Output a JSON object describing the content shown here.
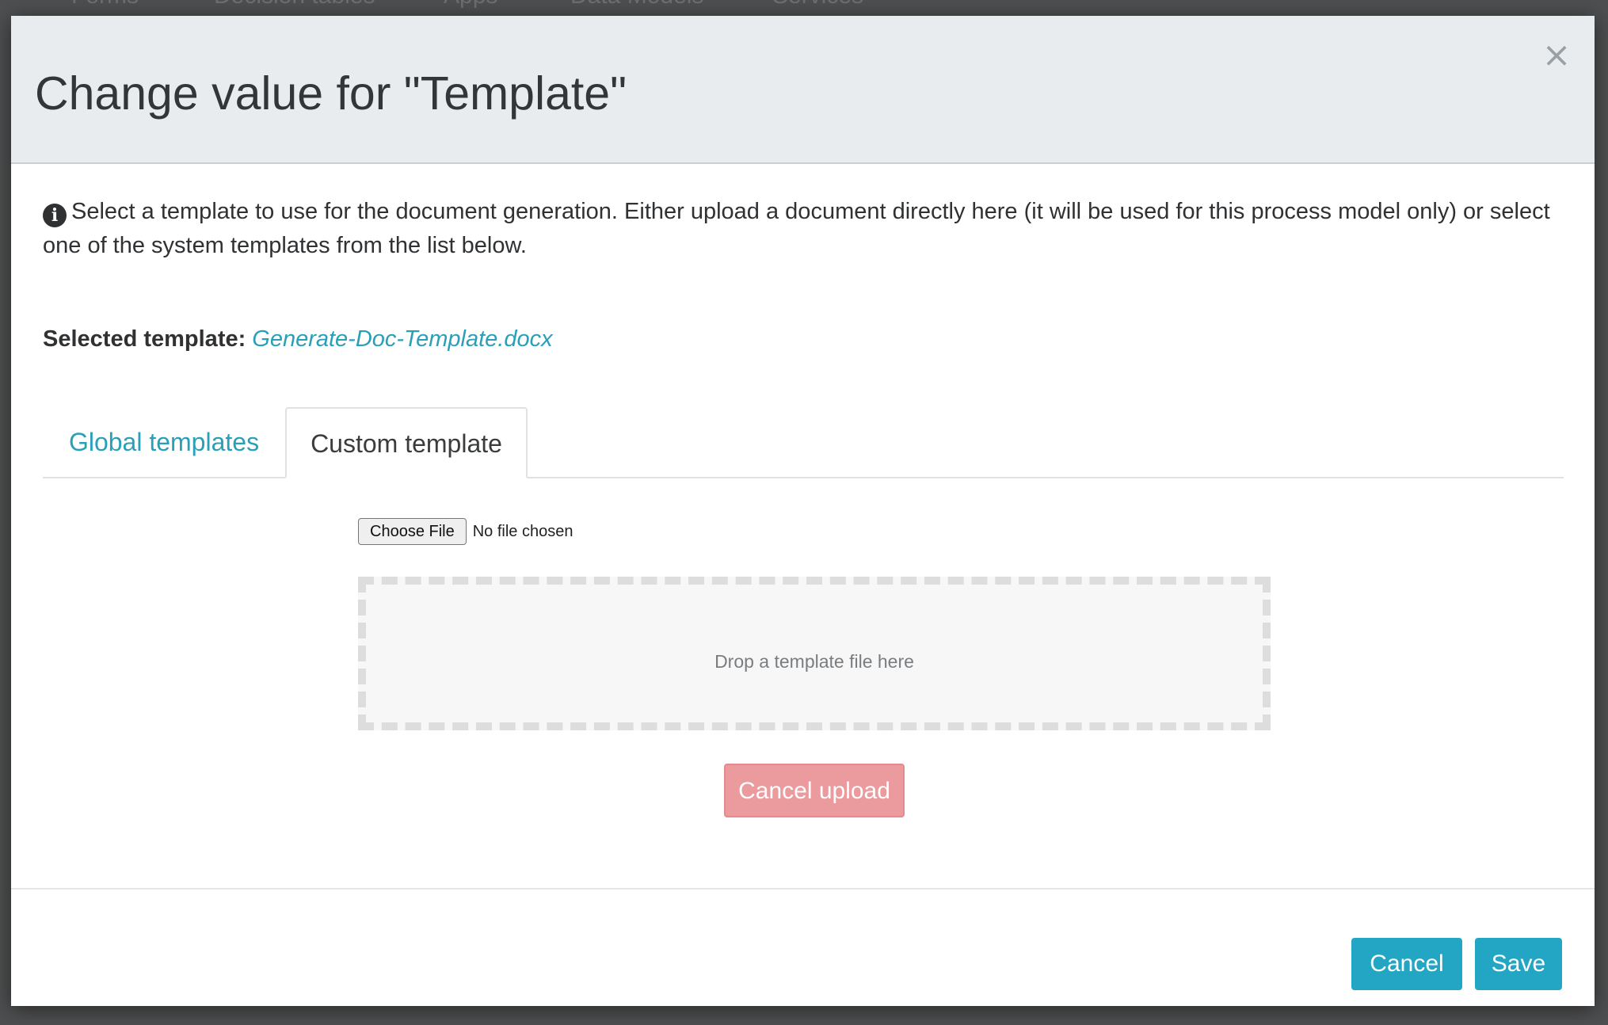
{
  "background_nav": [
    "Forms",
    "Decision tables",
    "Apps",
    "Data Models",
    "Services"
  ],
  "modal": {
    "title": "Change value for \"Template\"",
    "close_label": "×",
    "info_text": "Select a template to use for the document generation. Either upload a document directly here (it will be used for this process model only) or select one of the system templates from the list below.",
    "selected_label": "Selected template:",
    "selected_value": "Generate-Doc-Template.docx",
    "tabs": [
      {
        "label": "Global templates",
        "active": false
      },
      {
        "label": "Custom template",
        "active": true
      }
    ],
    "file_input": {
      "button_label": "Choose File",
      "status": "No file chosen"
    },
    "dropzone_text": "Drop a template file here",
    "cancel_upload_label": "Cancel upload",
    "footer": {
      "cancel_label": "Cancel",
      "save_label": "Save"
    }
  },
  "colors": {
    "accent": "#22a6c3",
    "link": "#2a9fb8",
    "danger_light": "#eb9a9e",
    "header_bg": "#e8ecef"
  },
  "icons": {
    "info": "info-circle-icon",
    "close": "close-icon"
  }
}
